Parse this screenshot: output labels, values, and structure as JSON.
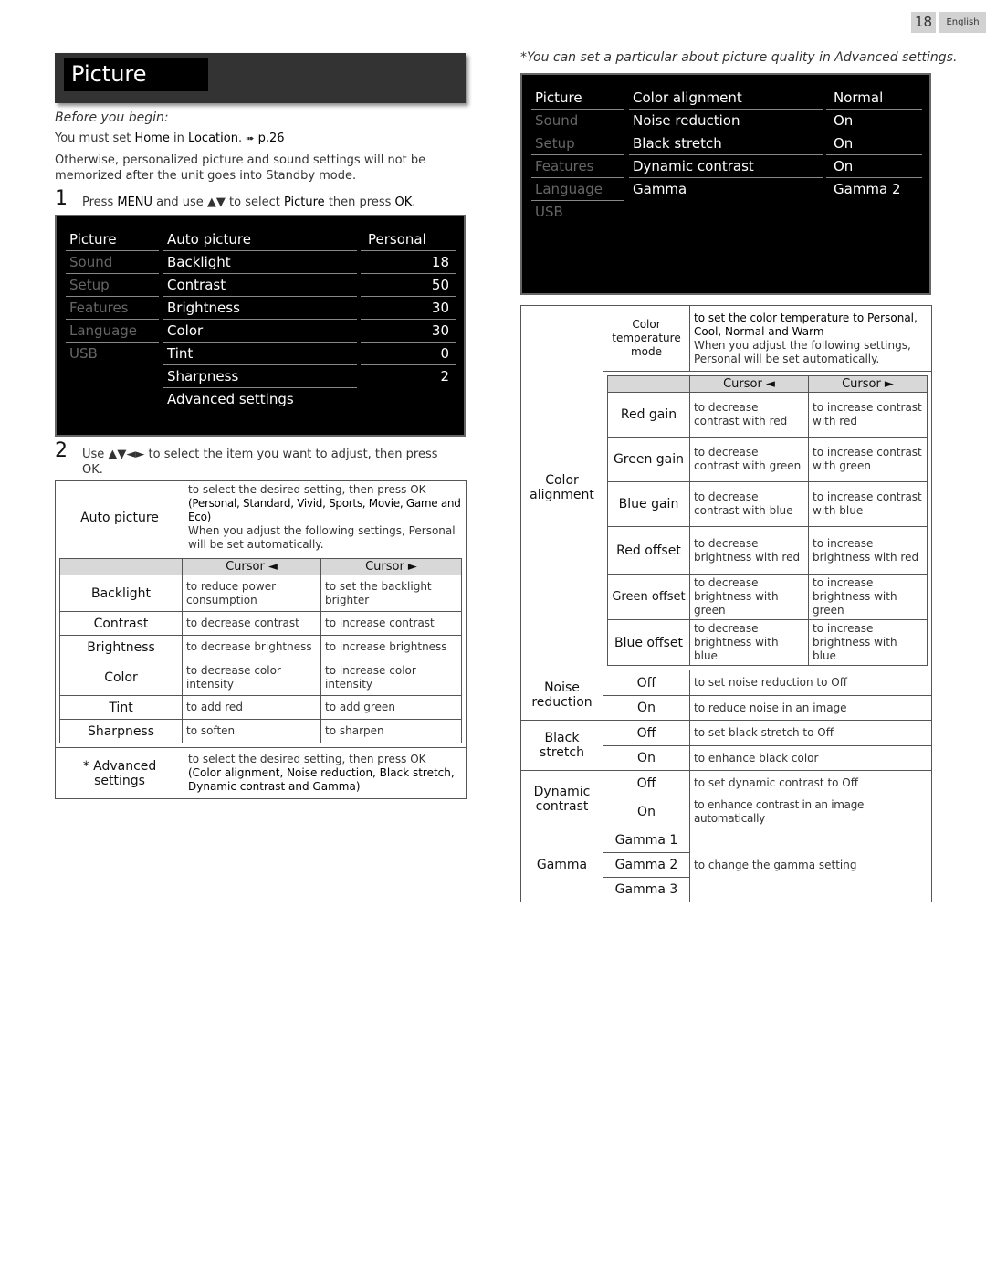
{
  "page": {
    "number": "18",
    "language": "English"
  },
  "section": {
    "title": "Picture"
  },
  "intro": {
    "before_heading": "Before you begin:",
    "must_set": {
      "prefix": "You must set ",
      "home": "Home",
      "mid": " in ",
      "location": "Location",
      "suffix": ".",
      "arrow": "➠",
      "ref": "p.26"
    },
    "otherwise": "Otherwise, personalized picture and sound settings will not be memorized after the unit goes into Standby mode."
  },
  "step1": {
    "num": "1",
    "pre": "Press ",
    "menu": "MENU",
    "mid": " and use ▲▼ to select ",
    "picture": "Picture",
    "mid2": " then press ",
    "ok": "OK",
    "end": "."
  },
  "menu1": {
    "categories": [
      "Picture",
      "Sound",
      "Setup",
      "Features",
      "Language",
      "USB"
    ],
    "items": [
      {
        "label": "Auto picture",
        "value": "Personal"
      },
      {
        "label": "Backlight",
        "value": "18"
      },
      {
        "label": "Contrast",
        "value": "50"
      },
      {
        "label": "Brightness",
        "value": "30"
      },
      {
        "label": "Color",
        "value": "30"
      },
      {
        "label": "Tint",
        "value": "0"
      },
      {
        "label": "Sharpness",
        "value": "2"
      },
      {
        "label": "Advanced settings",
        "value": ""
      }
    ]
  },
  "step2": {
    "num": "2",
    "text": "Use ▲▼◄► to select the item you want to adjust, then press OK."
  },
  "table1": {
    "auto_picture": {
      "label": "Auto picture",
      "line1": "to select the desired setting, then press OK",
      "line2": "(Personal, Standard, Vivid, Sports, Movie, Game and Eco)",
      "line3": "When you adjust the following settings, Personal will be set automatically."
    },
    "headers": [
      "",
      "Cursor ◄",
      "Cursor ►"
    ],
    "rows": [
      {
        "label": "Backlight",
        "left": "to reduce power consumption",
        "right": "to set the backlight brighter"
      },
      {
        "label": "Contrast",
        "left": "to decrease contrast",
        "right": "to increase contrast"
      },
      {
        "label": "Brightness",
        "left": "to decrease brightness",
        "right": "to increase brightness"
      },
      {
        "label": "Color",
        "left": "to decrease color intensity",
        "right": "to increase color intensity"
      },
      {
        "label": "Tint",
        "left": "to add red",
        "right": "to add green"
      },
      {
        "label": "Sharpness",
        "left": "to soften",
        "right": "to sharpen"
      }
    ],
    "advanced": {
      "label": "* Advanced settings",
      "line1": "to select the desired setting, then press OK",
      "line2": "(Color alignment, Noise reduction, Black stretch, Dynamic contrast and Gamma)"
    }
  },
  "note": "*You can set a particular about picture quality in Advanced settings.",
  "menu2": {
    "categories": [
      "Picture",
      "Sound",
      "Setup",
      "Features",
      "Language",
      "USB"
    ],
    "items": [
      {
        "label": "Color alignment",
        "value": "Normal"
      },
      {
        "label": "Noise reduction",
        "value": "On"
      },
      {
        "label": "Black stretch",
        "value": "On"
      },
      {
        "label": "Dynamic contrast",
        "value": "On"
      },
      {
        "label": "Gamma",
        "value": "Gamma 2"
      }
    ]
  },
  "table2": {
    "color_alignment": {
      "label": "Color alignment",
      "temp_label": "Color temperature mode",
      "temp_line1": "to set the color temperature to Personal, Cool, Normal and Warm",
      "temp_line2": "When you adjust the following settings, Personal will be set automatically.",
      "headers": [
        "",
        "Cursor ◄",
        "Cursor ►"
      ],
      "rows": [
        {
          "label": "Red gain",
          "left": "to decrease contrast with red",
          "right": "to increase contrast with red"
        },
        {
          "label": "Green gain",
          "left": "to decrease contrast with green",
          "right": "to increase contrast with green"
        },
        {
          "label": "Blue gain",
          "left": "to decrease contrast with blue",
          "right": "to increase contrast with blue"
        },
        {
          "label": "Red offset",
          "left": "to decrease brightness with red",
          "right": "to increase brightness with red"
        },
        {
          "label": "Green offset",
          "left": "to decrease brightness with green",
          "right": "to increase brightness with green"
        },
        {
          "label": "Blue offset",
          "left": "to decrease brightness with blue",
          "right": "to increase brightness with blue"
        }
      ]
    },
    "noise_reduction": {
      "label": "Noise reduction",
      "options": [
        {
          "opt": "Off",
          "desc": "to set noise reduction to Off"
        },
        {
          "opt": "On",
          "desc": "to reduce noise in an image"
        }
      ]
    },
    "black_stretch": {
      "label": "Black stretch",
      "options": [
        {
          "opt": "Off",
          "desc": "to set black stretch to Off"
        },
        {
          "opt": "On",
          "desc": "to enhance black color"
        }
      ]
    },
    "dynamic_contrast": {
      "label": "Dynamic contrast",
      "options": [
        {
          "opt": "Off",
          "desc": "to set dynamic contrast to Off"
        },
        {
          "opt": "On",
          "desc": "to enhance contrast in an image automatically"
        }
      ]
    },
    "gamma": {
      "label": "Gamma",
      "options": [
        "Gamma 1",
        "Gamma 2",
        "Gamma 3"
      ],
      "desc": "to change the gamma setting"
    }
  }
}
